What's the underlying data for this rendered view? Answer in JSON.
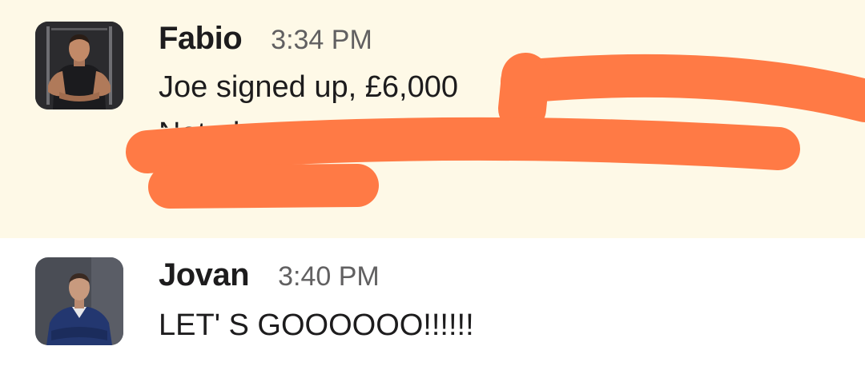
{
  "messages": [
    {
      "sender": "Fabio",
      "timestamp": "3:34 PM",
      "lines": [
        "Joe signed up, £6,000",
        "Noted"
      ],
      "avatar_icon": "person-avatar-icon",
      "highlighted": true,
      "redacted": true
    },
    {
      "sender": "Jovan",
      "timestamp": "3:40 PM",
      "lines": [
        "LET' S GOOOOOO!!!!!!"
      ],
      "avatar_icon": "person-avatar-icon",
      "highlighted": false
    }
  ],
  "colors": {
    "highlight_background": "#fef9e7",
    "redaction": "#ff7a45",
    "sender_text": "#1d1c1d",
    "timestamp_text": "#616061"
  }
}
